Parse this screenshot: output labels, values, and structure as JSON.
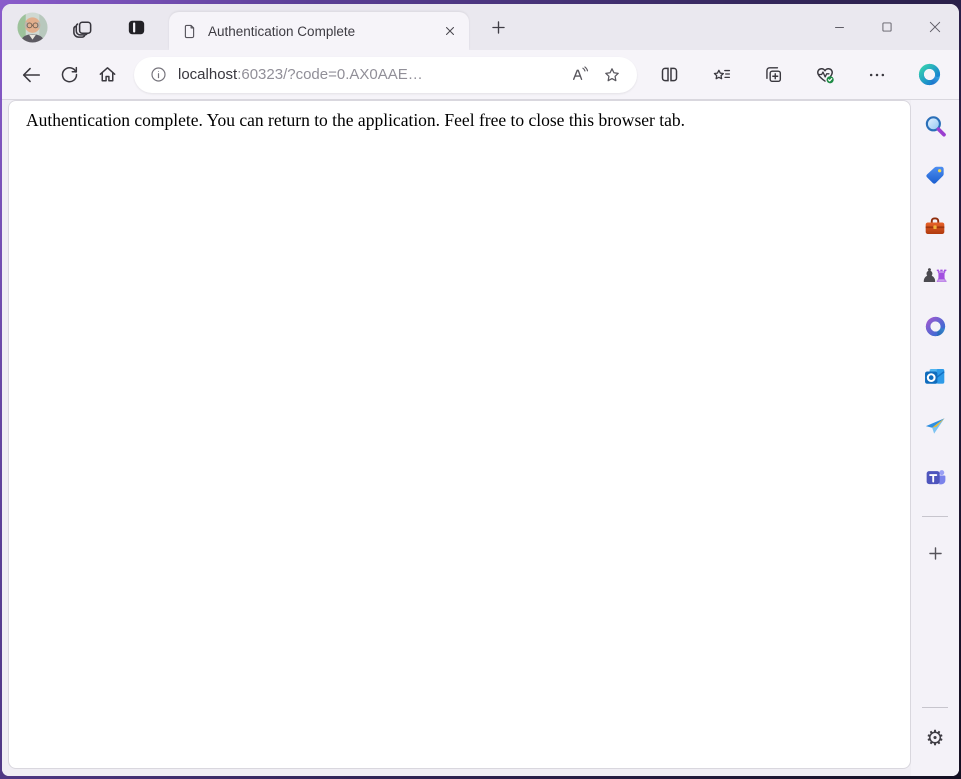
{
  "titlebar": {
    "tab_title": "Authentication Complete"
  },
  "toolbar": {
    "url_host": "localhost",
    "url_rest": ":60323/?code=0.AX0AAE…"
  },
  "page": {
    "message": "Authentication complete. You can return to the application. Feel free to close this browser tab."
  },
  "sidebar": {
    "items": [
      {
        "name": "search"
      },
      {
        "name": "shopping"
      },
      {
        "name": "tools"
      },
      {
        "name": "games"
      },
      {
        "name": "microsoft-365"
      },
      {
        "name": "outlook"
      },
      {
        "name": "drop"
      },
      {
        "name": "teams"
      }
    ],
    "pawn_glyph": "♟",
    "rook_glyph": "♜",
    "gear_glyph": "⚙"
  },
  "colors": {
    "window_border_purple": "#5b3f96",
    "chrome_bg": "#eae8ef",
    "toolbar_bg": "#f6f4f9",
    "copilot_blue": "#1273d6",
    "copilot_teal": "#35d0b0",
    "essentials_check_green": "#1c8a43",
    "url_host_text": "#39373e",
    "url_rest_text": "#918f98"
  }
}
